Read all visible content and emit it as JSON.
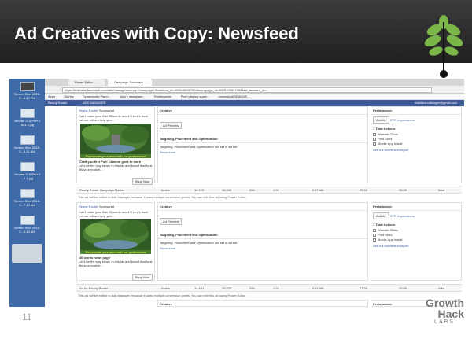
{
  "slide": {
    "title": "Ad Creatives with Copy: Newsfeed",
    "number": "11",
    "brand_line1": "Growth",
    "brand_line2": "Hack",
    "brand_line3": "LABS",
    "accent": "#7ab648"
  },
  "dock": {
    "items": [
      {
        "label": "Screen Shot 2015-0...6.40 PM",
        "dark": true
      },
      {
        "label": "Jerome G & Part 2 .541 2.jpg",
        "dark": false
      },
      {
        "label": "Screen Shot 2015-0...3.31 AM",
        "dark": false
      },
      {
        "label": "Jerome G & Part 2 ...1 1.jpg",
        "dark": false
      },
      {
        "label": "Screen Shot 2015-0...7.10 AM",
        "dark": false
      },
      {
        "label": "Screen Shot 2015-0...0.44 AM",
        "dark": false
      }
    ]
  },
  "browser": {
    "tabs": [
      "Power Editor",
      "Campaign Summary"
    ],
    "url": "https://business.facebook.com/ads/manage/summary/campaign/?business_id=4996450287004&campaign_id=6029199527495&ad_account_id=...",
    "bookmarks": [
      "Apps",
      "Stories",
      "Dynamically Plann...",
      "Alan's instagram...",
      "Riddlegamer",
      "Pixel playing again...",
      "unmasked/README..."
    ],
    "fb_left": "Ready Router",
    "fb_mid": "ADS MANAGER",
    "fb_right": "matthew.ralburger@gmail.com"
  },
  "ad1": {
    "page_name": "Ready Router",
    "sponsored": "Sponsored",
    "copy": "Can't make your first 35 words short? Here's how! Let our editors help you...",
    "caption": "Rejuvenate your mind with our professional",
    "headline": "'Craft you first Fuel Camera' goes to work",
    "body": "Let's be the way to win in this list and brand that best fits your market...",
    "cta": "Shop Now",
    "actions": "Like · Comment · Share"
  },
  "ad2": {
    "page_name": "Ready Router",
    "sponsored": "Sponsored",
    "copy": "Can't make your first 35 words short? Here's how! Let our editors help you...",
    "caption": "Rejuvenate your mind with our professional",
    "headline": "'40 words news page'",
    "body": "Let's be the way to win in this list and brand that best fits your market...",
    "cta": "Shop Now",
    "actions": "Like · Comment · Share"
  },
  "creative": {
    "header": "Creative",
    "preview_btn": "Ad Preview",
    "targeting_header": "Targeting, Placement and Optimization",
    "targeting_text": "Targeting, Placement and Optimization are set in ad set",
    "show_more": "Show more"
  },
  "performance": {
    "header": "Performance",
    "tabs": [
      "Activity",
      "CTR",
      "Impressions"
    ],
    "goal_label": "1 Total Actions",
    "checks": [
      "Website Clicks",
      "Post Likes",
      "Mobile App Install"
    ],
    "link": "See full conversion report"
  },
  "rows": [
    {
      "name": "Ready Router Campaign Router",
      "status": "Active",
      "reach": "18,723",
      "col1": "28,535",
      "col2": "286",
      "col3": "1.91",
      "col4": "0.47886",
      "col5": "25.52",
      "col6": "28.09",
      "col7": "Wed"
    },
    {
      "name": "Ad for Ready Router",
      "status": "Active",
      "reach": "12,441",
      "col1": "28,535",
      "col2": "286",
      "col3": "1.91",
      "col4": "0.47886",
      "col5": "21.55",
      "col6": "28.09",
      "col7": "Wed"
    }
  ],
  "row_note": "This ad will be edited in Ads Manager because it uses multiple conversion pixels. You can edit this ad using Power Editor."
}
